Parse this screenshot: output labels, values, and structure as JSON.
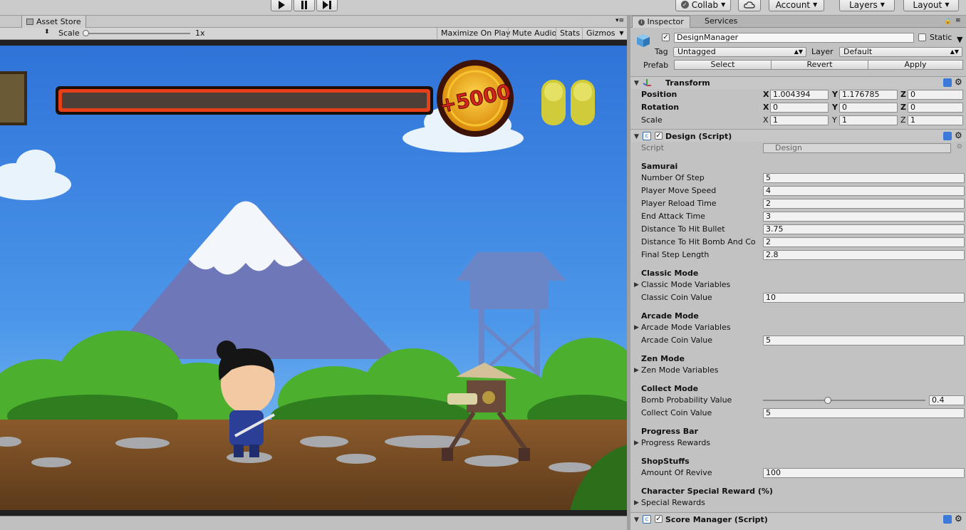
{
  "toolbar": {
    "collab_label": "Collab",
    "account_label": "Account",
    "layers_label": "Layers",
    "layout_label": "Layout"
  },
  "game_view": {
    "tab_label": "Asset Store",
    "scale_label": "Scale",
    "scale_value": "1x",
    "toggles": [
      "Maximize On Play",
      "Mute Audio",
      "Stats",
      "Gizmos"
    ],
    "hud_score": "+5000"
  },
  "inspector": {
    "tabs": [
      "Inspector",
      "Services"
    ],
    "object_name": "DesignManager",
    "static_label": "Static",
    "tag_label": "Tag",
    "tag_value": "Untagged",
    "layer_label": "Layer",
    "layer_value": "Default",
    "prefab_label": "Prefab",
    "prefab_buttons": [
      "Select",
      "Revert",
      "Apply"
    ],
    "transform": {
      "title": "Transform",
      "position_label": "Position",
      "rotation_label": "Rotation",
      "scale_label": "Scale",
      "position": {
        "x": "1.004394",
        "y": "1.176785",
        "z": "0"
      },
      "rotation": {
        "x": "0",
        "y": "0",
        "z": "0"
      },
      "scale": {
        "x": "1",
        "y": "1",
        "z": "1"
      },
      "axes": [
        "X",
        "Y",
        "Z"
      ]
    },
    "design": {
      "title": "Design (Script)",
      "script_label": "Script",
      "script_value": "Design",
      "samurai_header": "Samurai",
      "samurai_fields": [
        {
          "label": "Number Of Step",
          "value": "5"
        },
        {
          "label": "Player Move Speed",
          "value": "4"
        },
        {
          "label": "Player Reload Time",
          "value": "2"
        },
        {
          "label": "End Attack Time",
          "value": "3"
        },
        {
          "label": "Distance To Hit Bullet",
          "value": "3.75"
        },
        {
          "label": "Distance To Hit Bomb And Co",
          "value": "2"
        },
        {
          "label": "Final Step Length",
          "value": "2.8"
        }
      ],
      "classic_header": "Classic Mode",
      "classic_variables": "Classic Mode Variables",
      "classic_coin_label": "Classic Coin Value",
      "classic_coin_value": "10",
      "arcade_header": "Arcade Mode",
      "arcade_variables": "Arcade Mode Variables",
      "arcade_coin_label": "Arcade Coin Value",
      "arcade_coin_value": "5",
      "zen_header": "Zen Mode",
      "zen_variables": "Zen Mode Variables",
      "collect_header": "Collect Mode",
      "bomb_prob_label": "Bomb Probability Value",
      "bomb_prob_value": "0.4",
      "bomb_prob_fraction": 0.4,
      "collect_coin_label": "Collect Coin Value",
      "collect_coin_value": "5",
      "progress_header": "Progress Bar",
      "progress_rewards": "Progress Rewards",
      "shop_header": "ShopStuffs",
      "revive_label": "Amount Of Revive",
      "revive_value": "100",
      "special_header": "Character Special Reward (%)",
      "special_rewards": "Special Rewards"
    },
    "score_manager": {
      "title": "Score Manager (Script)"
    }
  }
}
